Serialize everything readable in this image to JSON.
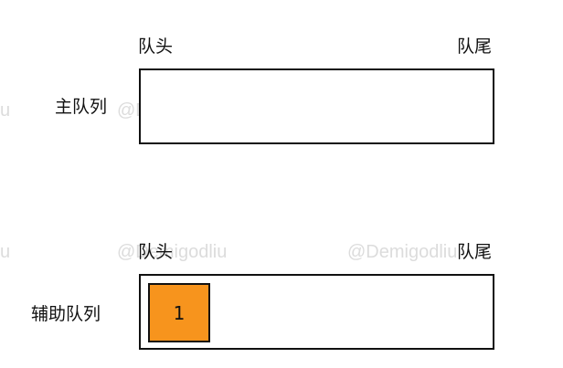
{
  "watermark": {
    "text": "@Demigodliu",
    "fragment": "u"
  },
  "main_queue": {
    "row_label": "主队列",
    "head_label": "队头",
    "tail_label": "队尾",
    "items": []
  },
  "aux_queue": {
    "row_label": "辅助队列",
    "head_label": "队头",
    "tail_label": "队尾",
    "items": [
      {
        "value": "1",
        "fill": "#f7941d"
      }
    ]
  }
}
